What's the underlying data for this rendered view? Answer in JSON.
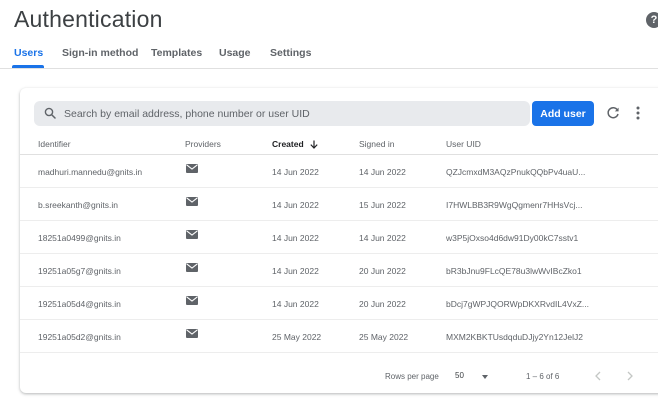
{
  "header": {
    "title": "Authentication",
    "help_icon": "help-circle-icon"
  },
  "tabs": [
    {
      "label": "Users",
      "active": true
    },
    {
      "label": "Sign-in method",
      "active": false
    },
    {
      "label": "Templates",
      "active": false
    },
    {
      "label": "Usage",
      "active": false
    },
    {
      "label": "Settings",
      "active": false
    }
  ],
  "toolbar": {
    "search_placeholder": "Search by email address, phone number or user UID",
    "add_user_label": "Add user",
    "refresh_icon": "refresh-icon",
    "more_icon": "more-vertical-icon"
  },
  "table": {
    "columns": [
      "Identifier",
      "Providers",
      "Created",
      "Signed in",
      "User UID"
    ],
    "sorted_column": "Created",
    "sort_direction": "descending",
    "provider_icon": "mail-icon",
    "rows": [
      {
        "identifier": "madhuri.mannedu@gnits.in",
        "provider": "email",
        "created": "14 Jun 2022",
        "signed_in": "14 Jun 2022",
        "uid": "QZJcmxdM3AQzPnukQQbPv4uaU..."
      },
      {
        "identifier": "b.sreekanth@gnits.in",
        "provider": "email",
        "created": "14 Jun 2022",
        "signed_in": "15 Jun 2022",
        "uid": "I7HWLBB3R9WgQgmenr7HHsVcj..."
      },
      {
        "identifier": "18251a0499@gnits.in",
        "provider": "email",
        "created": "14 Jun 2022",
        "signed_in": "14 Jun 2022",
        "uid": "w3P5jOxso4d6dw91Dy00kC7sstv1"
      },
      {
        "identifier": "19251a05g7@gnits.in",
        "provider": "email",
        "created": "14 Jun 2022",
        "signed_in": "20 Jun 2022",
        "uid": "bR3bJnu9FLcQE78u3lwWvIBcZko1"
      },
      {
        "identifier": "19251a05d4@gnits.in",
        "provider": "email",
        "created": "14 Jun 2022",
        "signed_in": "20 Jun 2022",
        "uid": "bDcj7gWPJQORWpDKXRvdIL4VxZ..."
      },
      {
        "identifier": "19251a05d2@gnits.in",
        "provider": "email",
        "created": "25 May 2022",
        "signed_in": "25 May 2022",
        "uid": "MXM2KBKTUsdqduDJjy2Yn12JelJ2"
      }
    ]
  },
  "pagination": {
    "rows_per_page_label": "Rows per page",
    "rows_per_page_value": "50",
    "range_text": "1 – 6 of 6"
  },
  "colors": {
    "accent": "#1a73e8",
    "text": "#3c4043",
    "muted": "#5f6368",
    "search_bg": "#e8eaed"
  }
}
